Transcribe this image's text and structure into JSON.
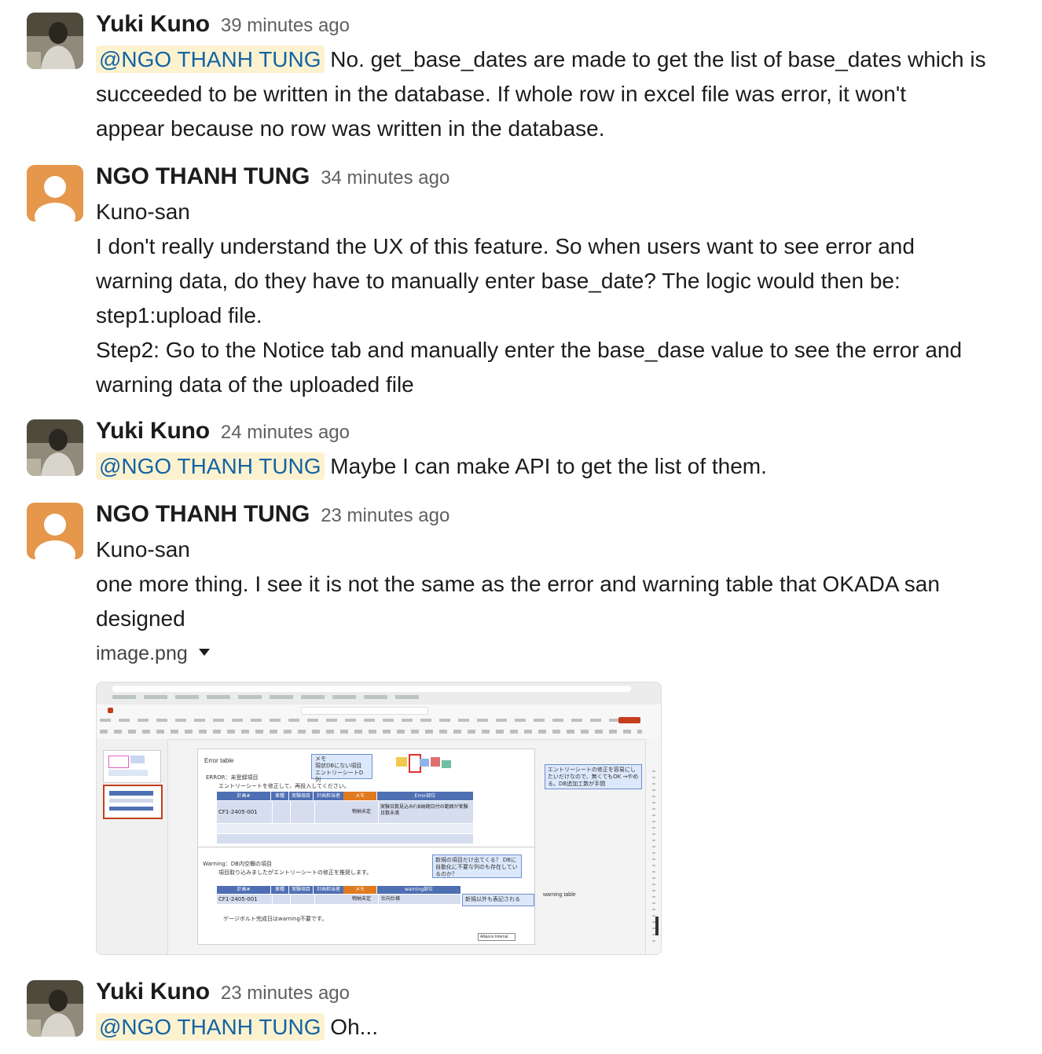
{
  "messages": [
    {
      "sender": "Yuki Kuno",
      "time": "39 minutes ago",
      "mention": "@NGO THANH TUNG",
      "lines": [
        "No. get_base_dates are made to get the list of base_dates which is",
        "succeeded to be written in the database. If whole row in excel file was error, it won't",
        "appear because no row was written in the database."
      ]
    },
    {
      "sender": "NGO THANH TUNG",
      "time": "34 minutes ago",
      "lines": [
        "Kuno-san",
        "I don't really understand the UX of this feature. So when users want to see error and",
        "warning data, do they have to manually enter base_date? The logic would then be:",
        "step1:upload file.",
        "Step2: Go to the Notice tab and manually enter the base_dase value to see the error and",
        "warning data of the uploaded file"
      ]
    },
    {
      "sender": "Yuki Kuno",
      "time": "24 minutes ago",
      "mention": "@NGO THANH TUNG",
      "lines": [
        "Maybe I can make API to get the list of them."
      ]
    },
    {
      "sender": "NGO THANH TUNG",
      "time": "23 minutes ago",
      "lines": [
        "Kuno-san",
        "one more thing. I see it is not the same as the error and warning table that OKADA san",
        "designed"
      ],
      "attachment": {
        "filename": "image.png",
        "slide": {
          "error_title": "Error table",
          "error_heading": "ERROR：未登録項目",
          "error_instruction": "エントリーシートを修正して、再投入してください。",
          "memo_top": "メモ",
          "memo_top_text": "現状DBにない項目 エントリーシートD列",
          "col_headers": [
            "計画#",
            "車種",
            "実験項目",
            "計画担当者",
            "メモ",
            "Error部位"
          ],
          "error_row": [
            "CF1-2405-001",
            "物納未定",
            "実験日数見込みF/B納期日付の範囲が実験日数未満"
          ],
          "right_note": "エントリーシートの修正を容易にしたいだけなので、無くてもOK →やめる。DB追加工数が手間",
          "warning_heading": "Warning：DB内空欄の項目",
          "warning_instruction": "項目取り込みましたがエントリーシートの修正を推奨します。",
          "warning_note": "新規の項目だけ出てくる？ DBに自動化に不要な列のも存在しているのか？",
          "warning_col": "warning部位",
          "warning_row": [
            "CF1-2405-001",
            "物納未定",
            "仕向仕様"
          ],
          "new_note": "新規以外も表記される",
          "warning_table_label": "warning table",
          "footer_note": "ゲージボルト完成日はwarning不要です。",
          "badge": "Alliance Internal"
        }
      }
    },
    {
      "sender": "Yuki Kuno",
      "time": "23 minutes ago",
      "mention": "@NGO THANH TUNG",
      "lines": [
        "Oh..."
      ]
    }
  ],
  "colors": {
    "mention_bg": "#fdf2d0",
    "mention_text": "#1264a3",
    "avatar_default": "#e5974b",
    "timestamp": "#616061"
  }
}
